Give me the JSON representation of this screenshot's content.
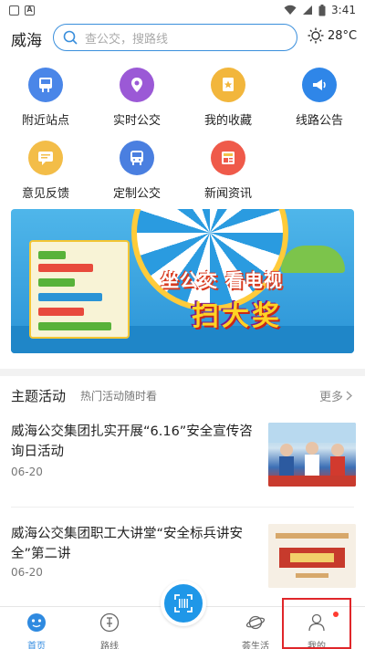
{
  "status_bar": {
    "time": "3:41",
    "left_icon_letter": "A"
  },
  "header": {
    "city": "威海",
    "search_placeholder": "查公交，搜路线",
    "temperature": "28°C"
  },
  "grid": {
    "items": [
      {
        "label": "附近站点",
        "icon": "bus-stop-icon",
        "color": "#4a86e8"
      },
      {
        "label": "实时公交",
        "icon": "location-pin-icon",
        "color": "#9b59d6"
      },
      {
        "label": "我的收藏",
        "icon": "star-icon",
        "color": "#f2b63c"
      },
      {
        "label": "线路公告",
        "icon": "megaphone-icon",
        "color": "#2f86e8"
      },
      {
        "label": "意见反馈",
        "icon": "chat-icon",
        "color": "#f3bd48"
      },
      {
        "label": "定制公交",
        "icon": "bus-icon",
        "color": "#4a7fe0"
      },
      {
        "label": "新闻资讯",
        "icon": "newspaper-icon",
        "color": "#ef5a4a"
      }
    ]
  },
  "banner": {
    "line1": "坐公交 看电视",
    "line2": "扫大奖"
  },
  "section": {
    "title": "主题活动",
    "subtitle": "热门活动随时看",
    "more": "更多"
  },
  "news": [
    {
      "title": "威海公交集团扎实开展“6.16”安全宣传咨询日活动",
      "date": "06-20"
    },
    {
      "title": "威海公交集团职工大讲堂“安全标兵讲安全”第二讲",
      "date": "06-20"
    }
  ],
  "tabbar": {
    "tabs": [
      {
        "label": "首页",
        "icon": "home-icon"
      },
      {
        "label": "路线",
        "icon": "route-icon"
      },
      {
        "label": "荟生活",
        "icon": "planet-icon"
      },
      {
        "label": "我的",
        "icon": "user-icon"
      }
    ]
  },
  "colors": {
    "accent": "#2f8ae0",
    "highlight": "#e0262a"
  }
}
